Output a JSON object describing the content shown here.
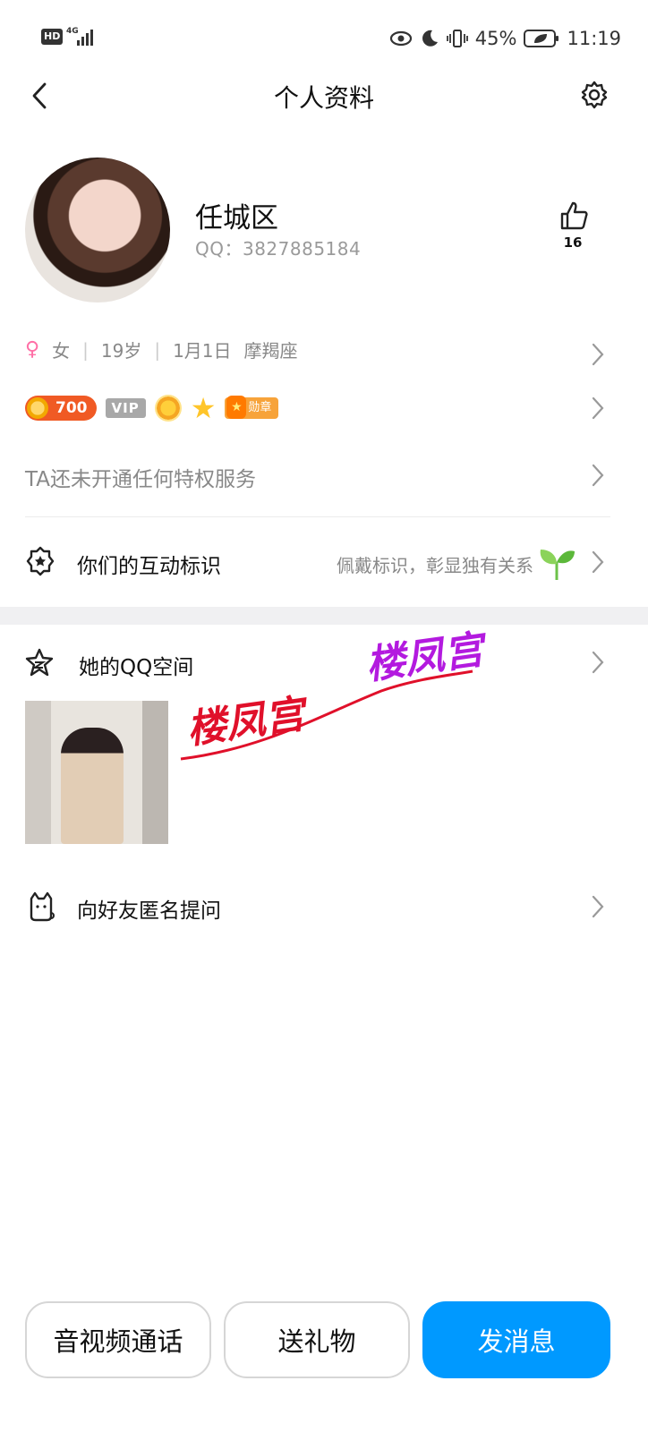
{
  "status_bar": {
    "hd": "HD",
    "network": "4G",
    "battery": "45%",
    "time": "11:19"
  },
  "nav": {
    "title": "个人资料"
  },
  "profile": {
    "name": "任城区",
    "qq": "QQ：3827885184",
    "likes": "16"
  },
  "info": {
    "gender_symbol": "♀",
    "gender": "女",
    "age": "19岁",
    "birthday": "1月1日",
    "zodiac": "摩羯座"
  },
  "badges": {
    "coin_value": "700",
    "vip_label": "VIP",
    "medal_label": "勋章"
  },
  "privilege": {
    "text": "TA还未开通任何特权服务"
  },
  "interaction": {
    "label": "你们的互动标识",
    "hint": "佩戴标识，彰显独有关系"
  },
  "qzone": {
    "label": "她的QQ空间"
  },
  "watermark": {
    "text1": "楼凤宫",
    "text2": "楼凤宫",
    "color1": "#e0102a",
    "color2": "#b31adf"
  },
  "ask": {
    "label": "向好友匿名提问"
  },
  "actions": {
    "call": "音视频通话",
    "gift": "送礼物",
    "message": "发消息"
  },
  "colors": {
    "accent": "#0099ff"
  }
}
